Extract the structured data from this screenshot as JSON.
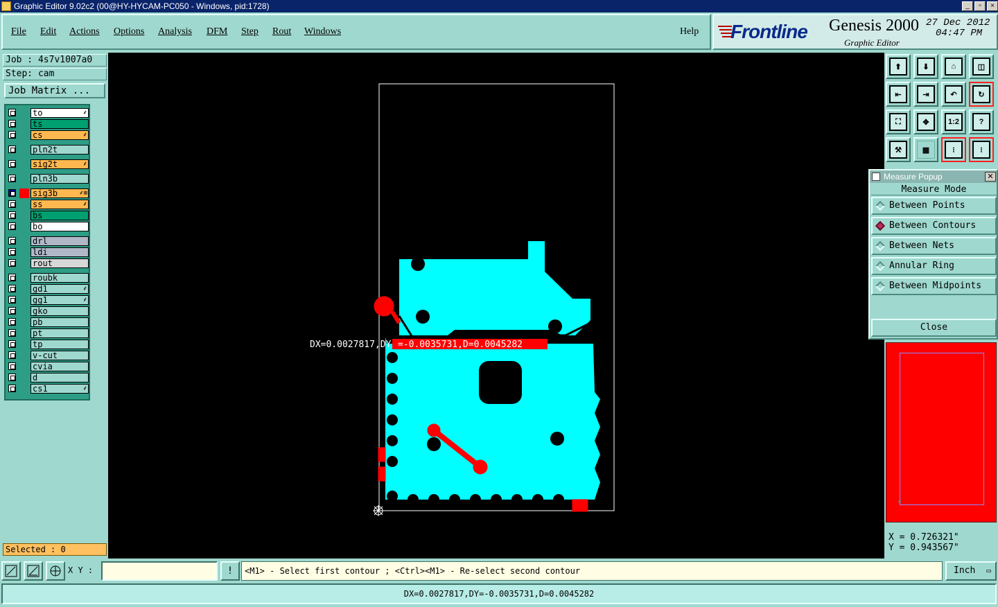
{
  "window": {
    "title": "Graphic Editor 9.02c2 (00@HY-HYCAM-PC050 - Windows, pid:1728)"
  },
  "menu": [
    "File",
    "Edit",
    "Actions",
    "Options",
    "Analysis",
    "DFM",
    "Step",
    "Rout",
    "Windows"
  ],
  "help_label": "Help",
  "brand": {
    "logo": "Frontline",
    "product": "Genesis 2000",
    "subtitle": "Graphic Editor",
    "date": "27 Dec 2012",
    "time": "04:47 PM"
  },
  "job": {
    "job_label": "Job : 4s7v1007a0",
    "step_label": "Step: cam",
    "matrix_button": "Job Matrix ..."
  },
  "layers": [
    {
      "name": "to",
      "color": "#ffffff",
      "mark": "⸙",
      "group": 0
    },
    {
      "name": "ts",
      "color": "#00a070",
      "mark": "",
      "group": 0
    },
    {
      "name": "cs",
      "color": "#ffb850",
      "mark": "⸙",
      "group": 0
    },
    {
      "name": "pln2t",
      "color": "#9fd8cf",
      "mark": "",
      "group": 1
    },
    {
      "name": "sig2t",
      "color": "#ffb850",
      "mark": "⸙",
      "group": 2
    },
    {
      "name": "pln3b",
      "color": "#9fd8cf",
      "mark": "",
      "group": 3
    },
    {
      "name": "sig3b",
      "color": "#ffb850",
      "mark": "⸙⊞",
      "group": 4
    },
    {
      "name": "ss",
      "color": "#ffb850",
      "mark": "⸙",
      "group": 4
    },
    {
      "name": "bs",
      "color": "#00a070",
      "mark": "",
      "group": 4
    },
    {
      "name": "bo",
      "color": "#ffffff",
      "mark": "",
      "group": 4
    },
    {
      "name": "drl",
      "color": "#b0b8c8",
      "mark": "",
      "group": 5
    },
    {
      "name": "ldi",
      "color": "#b0b8c8",
      "mark": "",
      "group": 5
    },
    {
      "name": "rout",
      "color": "#d8d8d8",
      "mark": "",
      "group": 5
    },
    {
      "name": "roubk",
      "color": "#9fd8cf",
      "mark": "",
      "group": 6
    },
    {
      "name": "gd1",
      "color": "#9fd8cf",
      "mark": "⸙",
      "group": 6
    },
    {
      "name": "gg1",
      "color": "#9fd8cf",
      "mark": "⸙",
      "group": 6
    },
    {
      "name": "gko",
      "color": "#9fd8cf",
      "mark": "",
      "group": 6
    },
    {
      "name": "pb",
      "color": "#9fd8cf",
      "mark": "",
      "group": 6
    },
    {
      "name": "pt",
      "color": "#9fd8cf",
      "mark": "",
      "group": 6
    },
    {
      "name": "tp",
      "color": "#9fd8cf",
      "mark": "",
      "group": 6
    },
    {
      "name": "v-cut",
      "color": "#9fd8cf",
      "mark": "",
      "group": 6
    },
    {
      "name": "cvia",
      "color": "#9fd8cf",
      "mark": "",
      "group": 6
    },
    {
      "name": "d",
      "color": "#9fd8cf",
      "mark": "",
      "group": 6
    },
    {
      "name": "cs1",
      "color": "#9fd8cf",
      "mark": "⸙",
      "group": 6
    }
  ],
  "selected_label": "Selected : 0",
  "canvas": {
    "measure_text_white": "DX=0.0027817,DY",
    "measure_text_red": "=-0.0035731,D=0.0045282"
  },
  "toolbar_icons": [
    "zoom-up-icon",
    "zoom-down-icon",
    "home-icon",
    "split-view-icon",
    "pan-left-icon",
    "pan-right-icon",
    "undo-view-icon",
    "redraw-icon",
    "fit-icon",
    "center-icon",
    "scale-1to2-icon",
    "help-icon",
    "tools-icon",
    "grid-icon",
    "layers-red-icon",
    "layers-red-alt-icon"
  ],
  "toolbar_text": {
    "scale": "1:2",
    "help": "?"
  },
  "measure_popup": {
    "title": "Measure Popup",
    "mode_label": "Measure Mode",
    "options": [
      "Between Points",
      "Between Contours",
      "Between Nets",
      "Annular Ring",
      "Between Midpoints"
    ],
    "selected_option": "Between Contours",
    "close_label": "Close"
  },
  "coords": {
    "x": "X = 0.726321\"",
    "y": "Y = 0.943567\""
  },
  "command": {
    "xy_label": "X Y :",
    "xy_value": "",
    "prompt_text": "<M1> - Select first contour ; <Ctrl><M1> - Re-select second contour",
    "unit": "Inch",
    "exclaim": "!"
  },
  "status_text": "DX=0.0027817,DY=-0.0035731,D=0.0045282",
  "colors": {
    "copper": "#00ffff",
    "highlight": "#ff0000",
    "panel": "#9fd8cf"
  }
}
